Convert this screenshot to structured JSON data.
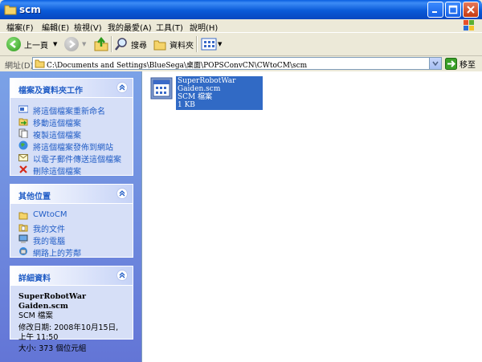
{
  "window": {
    "title": "scm"
  },
  "menu": [
    "檔案(F)",
    "編輯(E)",
    "檢視(V)",
    "我的最愛(A)",
    "工具(T)",
    "說明(H)"
  ],
  "toolbar": {
    "back_label": "上一頁",
    "search_label": "搜尋",
    "folders_label": "資料夾"
  },
  "address": {
    "label": "網址(D)",
    "path": "C:\\Documents and Settings\\BlueSega\\桌面\\POPSConvCN\\CWtoCM\\scm",
    "go_label": "移至"
  },
  "file_tasks": {
    "title": "檔案及資料夾工作",
    "items": [
      {
        "label": "將這個檔案重新命名",
        "icon": "rename-icon"
      },
      {
        "label": "移動這個檔案",
        "icon": "move-icon"
      },
      {
        "label": "複製這個檔案",
        "icon": "copy-icon"
      },
      {
        "label": "將這個檔案發佈到網站",
        "icon": "publish-web-icon"
      },
      {
        "label": "以電子郵件傳送這個檔案",
        "icon": "email-icon"
      },
      {
        "label": "刪除這個檔案",
        "icon": "delete-icon"
      }
    ]
  },
  "other_places": {
    "title": "其他位置",
    "items": [
      {
        "label": "CWtoCM",
        "icon": "folder-icon"
      },
      {
        "label": "我的文件",
        "icon": "my-documents-icon"
      },
      {
        "label": "我的電腦",
        "icon": "my-computer-icon"
      },
      {
        "label": "網路上的芳鄰",
        "icon": "network-icon"
      }
    ]
  },
  "details": {
    "title": "詳細資料",
    "file_name": "SuperRobotWar Gaiden.scm",
    "file_type": "SCM 檔案",
    "modified": "修改日期: 2008年10月15日, 上午 11:50",
    "size": "大小: 373 個位元組"
  },
  "file": {
    "name": "SuperRobotWar Gaiden.scm",
    "type": "SCM 檔案",
    "size": "1 KB"
  }
}
